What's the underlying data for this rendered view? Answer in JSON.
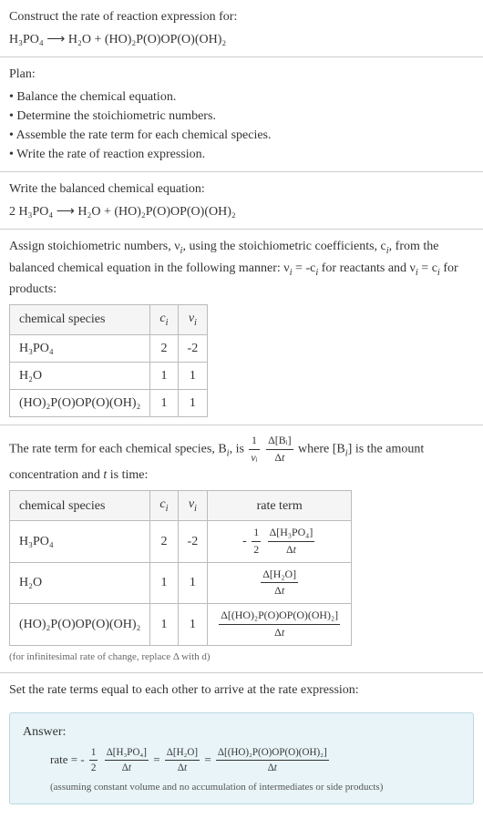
{
  "section1": {
    "prompt": "Construct the rate of reaction expression for:",
    "equation_lhs": "H",
    "equation": "H₃PO₄  ⟶  H₂O + (HO)₂P(O)OP(O)(OH)₂"
  },
  "plan": {
    "title": "Plan:",
    "items": [
      "• Balance the chemical equation.",
      "• Determine the stoichiometric numbers.",
      "• Assemble the rate term for each chemical species.",
      "• Write the rate of reaction expression."
    ]
  },
  "balanced": {
    "title": "Write the balanced chemical equation:",
    "equation": "2 H₃PO₄  ⟶  H₂O + (HO)₂P(O)OP(O)(OH)₂"
  },
  "stoich": {
    "intro_a": "Assign stoichiometric numbers, ν",
    "intro_b": ", using the stoichiometric coefficients, c",
    "intro_c": ", from the balanced chemical equation in the following manner: ν",
    "intro_d": " = -c",
    "intro_e": " for reactants and ν",
    "intro_f": " = c",
    "intro_g": " for products:",
    "headers": {
      "species": "chemical species",
      "ci": "cᵢ",
      "vi": "νᵢ"
    },
    "rows": [
      {
        "species": "H₃PO₄",
        "ci": "2",
        "vi": "-2"
      },
      {
        "species": "H₂O",
        "ci": "1",
        "vi": "1"
      },
      {
        "species": "(HO)₂P(O)OP(O)(OH)₂",
        "ci": "1",
        "vi": "1"
      }
    ]
  },
  "rateterm": {
    "intro_a": "The rate term for each chemical species, B",
    "intro_b": ", is ",
    "intro_c": " where [B",
    "intro_d": "] is the amount concentration and ",
    "intro_e": " is time:",
    "frac1_num": "1",
    "frac1_den": "νᵢ",
    "frac2_num": "Δ[Bᵢ]",
    "frac2_den": "Δt",
    "t_var": "t",
    "headers": {
      "species": "chemical species",
      "ci": "cᵢ",
      "vi": "νᵢ",
      "rate": "rate term"
    },
    "rows": [
      {
        "species": "H₃PO₄",
        "ci": "2",
        "vi": "-2",
        "neg": "-",
        "coef_num": "1",
        "coef_den": "2",
        "dnum": "Δ[H₃PO₄]",
        "dden": "Δt"
      },
      {
        "species": "H₂O",
        "ci": "1",
        "vi": "1",
        "neg": "",
        "coef_num": "",
        "coef_den": "",
        "dnum": "Δ[H₂O]",
        "dden": "Δt"
      },
      {
        "species": "(HO)₂P(O)OP(O)(OH)₂",
        "ci": "1",
        "vi": "1",
        "neg": "",
        "coef_num": "",
        "coef_den": "",
        "dnum": "Δ[(HO)₂P(O)OP(O)(OH)₂]",
        "dden": "Δt"
      }
    ],
    "note": "(for infinitesimal rate of change, replace Δ with d)"
  },
  "final": {
    "intro": "Set the rate terms equal to each other to arrive at the rate expression:",
    "answer_label": "Answer:",
    "rate_eq_prefix": "rate = -",
    "half_num": "1",
    "half_den": "2",
    "t1_num": "Δ[H₃PO₄]",
    "t1_den": "Δt",
    "eq": " = ",
    "t2_num": "Δ[H₂O]",
    "t2_den": "Δt",
    "t3_num": "Δ[(HO)₂P(O)OP(O)(OH)₂]",
    "t3_den": "Δt",
    "note": "(assuming constant volume and no accumulation of intermediates or side products)"
  },
  "chart_data": {
    "type": "table",
    "tables": [
      {
        "title": "stoichiometric numbers",
        "columns": [
          "chemical species",
          "c_i",
          "ν_i"
        ],
        "rows": [
          [
            "H3PO4",
            2,
            -2
          ],
          [
            "H2O",
            1,
            1
          ],
          [
            "(HO)2P(O)OP(O)(OH)2",
            1,
            1
          ]
        ]
      },
      {
        "title": "rate terms",
        "columns": [
          "chemical species",
          "c_i",
          "ν_i",
          "rate term"
        ],
        "rows": [
          [
            "H3PO4",
            2,
            -2,
            "-(1/2) Δ[H3PO4]/Δt"
          ],
          [
            "H2O",
            1,
            1,
            "Δ[H2O]/Δt"
          ],
          [
            "(HO)2P(O)OP(O)(OH)2",
            1,
            1,
            "Δ[(HO)2P(O)OP(O)(OH)2]/Δt"
          ]
        ]
      }
    ]
  }
}
